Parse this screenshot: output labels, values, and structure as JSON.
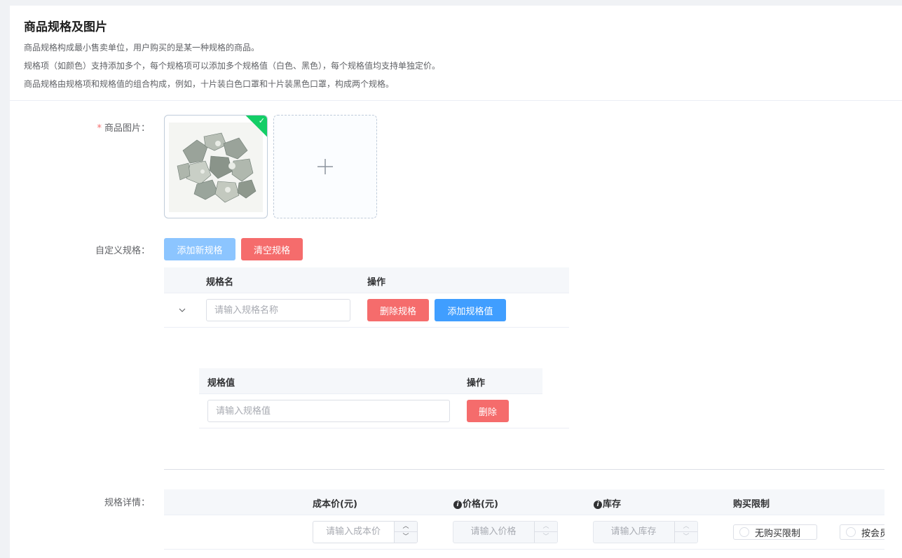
{
  "section": {
    "title": "商品规格及图片",
    "desc": [
      "商品规格构成最小售卖单位，用户购买的是某一种规格的商品。",
      "规格项（如颜色）支持添加多个，每个规格项可以添加多个规格值（白色、黑色），每个规格值均支持单独定价。",
      "商品规格由规格项和规格值的组合构成，例如，十片装白色口罩和十片装黑色口罩，构成两个规格。"
    ]
  },
  "images": {
    "label": "商品图片：",
    "required_mark": "*",
    "upload_icon": "plus-icon",
    "success_icon": "check-icon"
  },
  "custom_spec": {
    "label": "自定义规格：",
    "add_button": "添加新规格",
    "clear_button": "清空规格",
    "table": {
      "col_name": "规格名",
      "col_action": "操作",
      "name_placeholder": "请输入规格名称",
      "delete_button": "删除规格",
      "add_value_button": "添加规格值",
      "expand_icon": "chevron-down-icon"
    },
    "values_table": {
      "col_value": "规格值",
      "col_action": "操作",
      "value_placeholder": "请输入规格值",
      "delete_button": "删除"
    }
  },
  "spec_detail": {
    "label": "规格详情：",
    "columns": {
      "cost": "成本价(元)",
      "price": "价格(元)",
      "stock": "库存",
      "limit": "购买限制"
    },
    "row": {
      "cost_placeholder": "请输入成本价",
      "price_placeholder": "请输入价格",
      "stock_placeholder": "请输入库存",
      "limit_options": [
        "无购买限制",
        "按会员"
      ]
    },
    "info_icon": "info-icon"
  },
  "colors": {
    "primary": "#409eff",
    "primary_light": "#8cc5ff",
    "danger": "#f56c6c",
    "success": "#13ce66"
  }
}
